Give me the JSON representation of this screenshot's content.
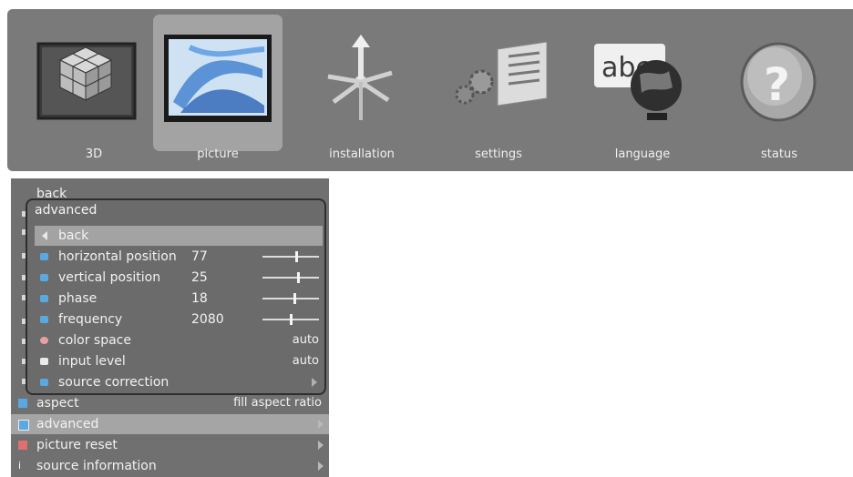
{
  "top_menu": {
    "tabs": [
      {
        "label": "3D",
        "icon": "cube-3d-icon"
      },
      {
        "label": "picture",
        "icon": "picture-icon",
        "selected": true
      },
      {
        "label": "installation",
        "icon": "installation-icon"
      },
      {
        "label": "settings",
        "icon": "settings-icon"
      },
      {
        "label": "language",
        "icon": "language-icon",
        "icon_text": "abc"
      },
      {
        "label": "status",
        "icon": "status-icon"
      }
    ]
  },
  "main_menu": {
    "back_label": "back",
    "items": [
      {
        "label": "aspect",
        "value": "fill aspect ratio"
      },
      {
        "label": "advanced",
        "selected": true
      },
      {
        "label": "picture reset"
      },
      {
        "label": "source information"
      }
    ]
  },
  "advanced_menu": {
    "title": "advanced",
    "back_label": "back",
    "items": [
      {
        "label": "horizontal position",
        "value": "77"
      },
      {
        "label": "vertical position",
        "value": "25"
      },
      {
        "label": "phase",
        "value": "18"
      },
      {
        "label": "frequency",
        "value": "2080"
      },
      {
        "label": "color space",
        "value": "auto"
      },
      {
        "label": "input level",
        "value": "auto"
      },
      {
        "label": "source correction"
      }
    ]
  },
  "colors": {
    "menu_bg": "#707070",
    "selected_bg": "#a3a3a3",
    "accent_blue": "#5aa8e0"
  }
}
